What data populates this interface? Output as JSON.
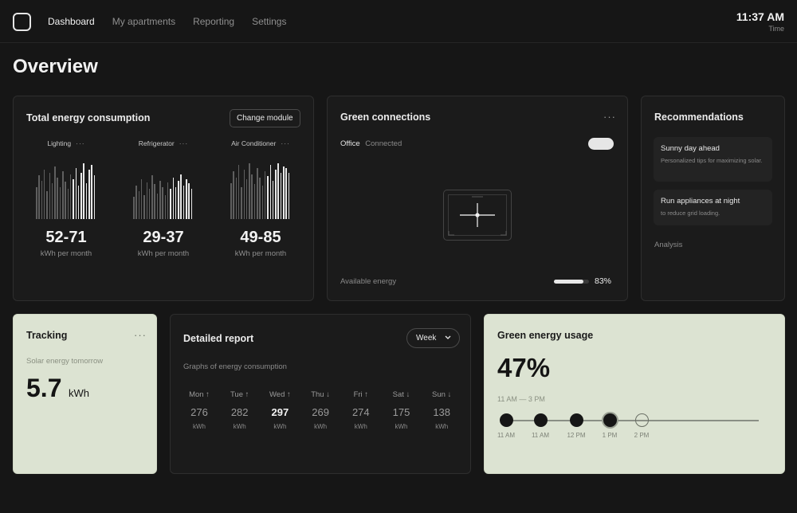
{
  "nav": {
    "items": [
      {
        "label": "Dashboard",
        "active": true
      },
      {
        "label": "My apartments",
        "active": false
      },
      {
        "label": "Reporting",
        "active": false
      },
      {
        "label": "Settings",
        "active": false
      }
    ]
  },
  "clock": {
    "time": "11:37 AM",
    "label": "Time"
  },
  "page_title": "Overview",
  "energy": {
    "title": "Total energy consumption",
    "change_button": "Change module",
    "meters": [
      {
        "name": "Lighting",
        "range": "52-71",
        "unit": "kWh per month"
      },
      {
        "name": "Refrigerator",
        "range": "29-37",
        "unit": "kWh per month"
      },
      {
        "name": "Air Conditioner",
        "range": "49-85",
        "unit": "kWh per month"
      }
    ],
    "menu_icon": "more-horizontal-icon"
  },
  "connections": {
    "title": "Green connections",
    "device_name": "Office",
    "device_status": "Connected",
    "toggle_on": true,
    "available_label": "Available energy",
    "available_value": "83%",
    "available_fraction": 0.83
  },
  "recommendations": {
    "title": "Recommendations",
    "items": [
      {
        "title": "Sunny day ahead",
        "subtitle": "Personalized tips for maximizing solar."
      },
      {
        "title": "Run appliances at night",
        "subtitle": "to reduce grid loading."
      }
    ],
    "analysis_label": "Analysis"
  },
  "tracking": {
    "title": "Tracking",
    "subtitle": "Solar energy tomorrow",
    "value": "5.7",
    "unit": "kWh"
  },
  "report": {
    "title": "Detailed report",
    "period_button": "Week",
    "subtitle": "Graphs of energy consumption",
    "days": [
      {
        "label": "Mon ↑",
        "value": "276",
        "unit": "kWh",
        "highlight": false
      },
      {
        "label": "Tue ↑",
        "value": "282",
        "unit": "kWh",
        "highlight": false
      },
      {
        "label": "Wed ↑",
        "value": "297",
        "unit": "kWh",
        "highlight": true
      },
      {
        "label": "Thu ↓",
        "value": "269",
        "unit": "kWh",
        "highlight": false
      },
      {
        "label": "Fri ↑",
        "value": "274",
        "unit": "kWh",
        "highlight": false
      },
      {
        "label": "Sat ↓",
        "value": "175",
        "unit": "kWh",
        "highlight": false
      },
      {
        "label": "Sun ↓",
        "value": "138",
        "unit": "kWh",
        "highlight": false
      }
    ]
  },
  "green_usage": {
    "title": "Green energy usage",
    "percent": "47%",
    "range": "11 AM — 3 PM",
    "timeline": [
      {
        "label": "11 AM",
        "filled": true
      },
      {
        "label": "11 AM",
        "filled": true
      },
      {
        "label": "12 PM",
        "filled": true
      },
      {
        "label": "1 PM",
        "filled": true
      },
      {
        "label": "2 PM",
        "filled": false
      }
    ]
  },
  "colors": {
    "background": "#161616",
    "card": "#1b1b1b",
    "light_card": "#dce3d2",
    "accent": "#e8e8e8"
  }
}
